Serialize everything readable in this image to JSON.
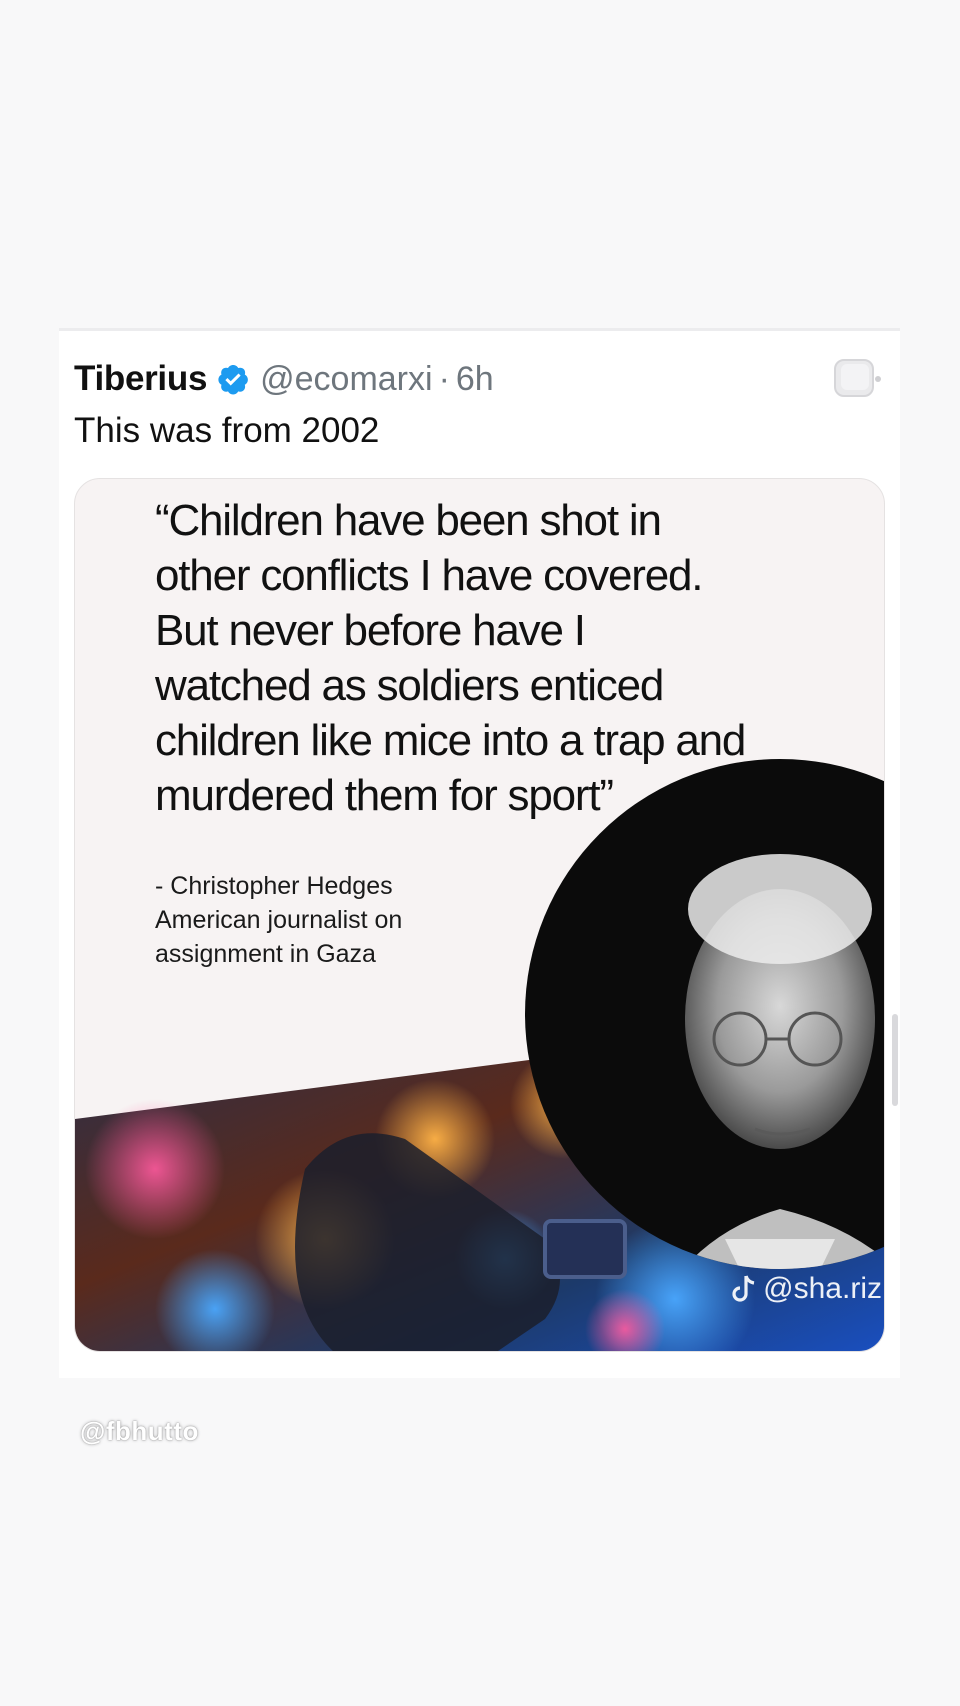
{
  "tweet": {
    "display_name": "Tiberius",
    "handle": "@ecomarxi",
    "separator": "·",
    "time": "6h",
    "text": "This was from 2002"
  },
  "media": {
    "quote_lines": [
      "“Children have been shot in",
      "other conflicts I have covered.",
      "But never before have I",
      "watched as soldiers enticed",
      "children like mice into a trap and",
      "murdered them for sport”"
    ],
    "attribution_lines": [
      "- Christopher Hedges",
      "American journalist on",
      "assignment in Gaza"
    ],
    "tiktok_watermark": "@sha.riz"
  },
  "story": {
    "mention": "@fbhutto"
  },
  "colors": {
    "page_background": "#f8f8f9",
    "verified_blue": "#1d9bf0",
    "handle_gray": "#6e767d",
    "media_background": "#f7f3f3"
  },
  "icons": {
    "verified": "verified-badge-icon",
    "more": "more-options-icon",
    "tiktok": "tiktok-icon"
  }
}
